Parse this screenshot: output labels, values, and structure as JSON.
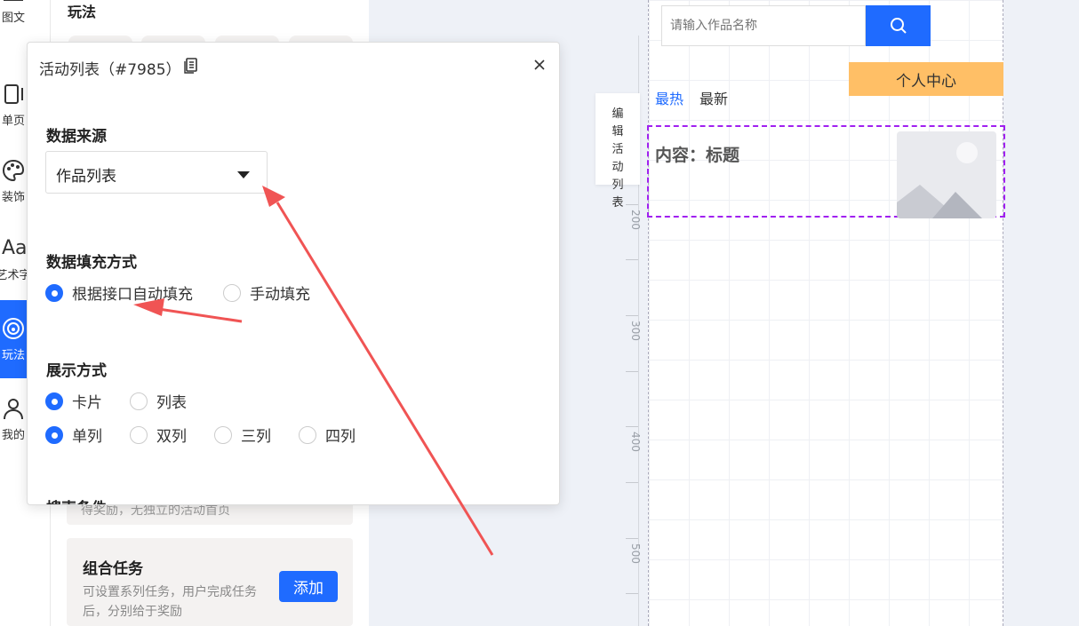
{
  "sidebar": {
    "items": [
      {
        "label": "图文",
        "icon": "image-text-icon"
      },
      {
        "label": "单页",
        "icon": "single-page-icon"
      },
      {
        "label": "装饰",
        "icon": "palette-icon"
      },
      {
        "label": "艺术字",
        "icon": "art-text-icon"
      },
      {
        "label": "玩法",
        "icon": "gameplay-icon",
        "active": true
      },
      {
        "label": "我的",
        "icon": "user-icon"
      }
    ]
  },
  "panel": {
    "title": "玩法",
    "hint_text": "得奖励，无独立的活动首页",
    "combo_task": {
      "title": "组合任务",
      "desc": "可设置系列任务，用户完成任务后，分别给于奖励",
      "add_label": "添加"
    }
  },
  "dialog": {
    "title": "活动列表（#7985）",
    "data_source": {
      "label": "数据来源",
      "selected": "作品列表"
    },
    "fill_mode": {
      "label": "数据填充方式",
      "options": [
        "根据接口自动填充",
        "手动填充"
      ],
      "selected": "根据接口自动填充"
    },
    "display_mode": {
      "label": "展示方式",
      "style_options": [
        "卡片",
        "列表"
      ],
      "style_selected": "卡片",
      "column_options": [
        "单列",
        "双列",
        "三列",
        "四列"
      ],
      "column_selected": "单列"
    },
    "cut_label": "搜索条件"
  },
  "canvas": {
    "ruler": [
      "200",
      "300",
      "400",
      "500"
    ],
    "edit_button": "编辑活动列表",
    "search": {
      "placeholder": "请输入作品名称"
    },
    "personal_center": "个人中心",
    "tabs": [
      "最热",
      "最新"
    ],
    "item_title": "内容：标题"
  },
  "colors": {
    "primary": "#1f6bff",
    "personal_center_bg": "#ffbf66",
    "selection_border": "#a020f0",
    "annotation_arrow": "#f05454"
  }
}
